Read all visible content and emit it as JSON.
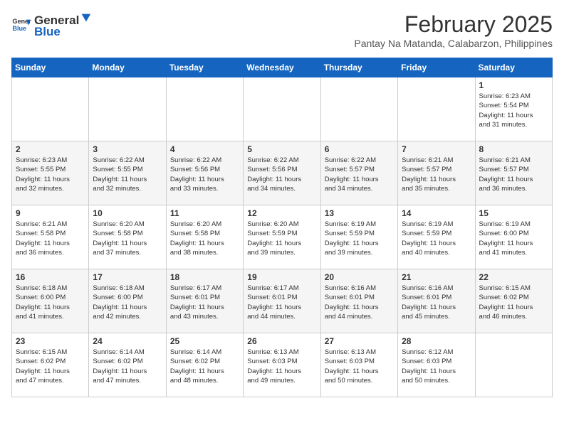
{
  "header": {
    "logo_general": "General",
    "logo_blue": "Blue",
    "month_title": "February 2025",
    "subtitle": "Pantay Na Matanda, Calabarzon, Philippines"
  },
  "days_of_week": [
    "Sunday",
    "Monday",
    "Tuesday",
    "Wednesday",
    "Thursday",
    "Friday",
    "Saturday"
  ],
  "weeks": [
    [
      {
        "num": "",
        "info": ""
      },
      {
        "num": "",
        "info": ""
      },
      {
        "num": "",
        "info": ""
      },
      {
        "num": "",
        "info": ""
      },
      {
        "num": "",
        "info": ""
      },
      {
        "num": "",
        "info": ""
      },
      {
        "num": "1",
        "info": "Sunrise: 6:23 AM\nSunset: 5:54 PM\nDaylight: 11 hours\nand 31 minutes."
      }
    ],
    [
      {
        "num": "2",
        "info": "Sunrise: 6:23 AM\nSunset: 5:55 PM\nDaylight: 11 hours\nand 32 minutes."
      },
      {
        "num": "3",
        "info": "Sunrise: 6:22 AM\nSunset: 5:55 PM\nDaylight: 11 hours\nand 32 minutes."
      },
      {
        "num": "4",
        "info": "Sunrise: 6:22 AM\nSunset: 5:56 PM\nDaylight: 11 hours\nand 33 minutes."
      },
      {
        "num": "5",
        "info": "Sunrise: 6:22 AM\nSunset: 5:56 PM\nDaylight: 11 hours\nand 34 minutes."
      },
      {
        "num": "6",
        "info": "Sunrise: 6:22 AM\nSunset: 5:57 PM\nDaylight: 11 hours\nand 34 minutes."
      },
      {
        "num": "7",
        "info": "Sunrise: 6:21 AM\nSunset: 5:57 PM\nDaylight: 11 hours\nand 35 minutes."
      },
      {
        "num": "8",
        "info": "Sunrise: 6:21 AM\nSunset: 5:57 PM\nDaylight: 11 hours\nand 36 minutes."
      }
    ],
    [
      {
        "num": "9",
        "info": "Sunrise: 6:21 AM\nSunset: 5:58 PM\nDaylight: 11 hours\nand 36 minutes."
      },
      {
        "num": "10",
        "info": "Sunrise: 6:20 AM\nSunset: 5:58 PM\nDaylight: 11 hours\nand 37 minutes."
      },
      {
        "num": "11",
        "info": "Sunrise: 6:20 AM\nSunset: 5:58 PM\nDaylight: 11 hours\nand 38 minutes."
      },
      {
        "num": "12",
        "info": "Sunrise: 6:20 AM\nSunset: 5:59 PM\nDaylight: 11 hours\nand 39 minutes."
      },
      {
        "num": "13",
        "info": "Sunrise: 6:19 AM\nSunset: 5:59 PM\nDaylight: 11 hours\nand 39 minutes."
      },
      {
        "num": "14",
        "info": "Sunrise: 6:19 AM\nSunset: 5:59 PM\nDaylight: 11 hours\nand 40 minutes."
      },
      {
        "num": "15",
        "info": "Sunrise: 6:19 AM\nSunset: 6:00 PM\nDaylight: 11 hours\nand 41 minutes."
      }
    ],
    [
      {
        "num": "16",
        "info": "Sunrise: 6:18 AM\nSunset: 6:00 PM\nDaylight: 11 hours\nand 41 minutes."
      },
      {
        "num": "17",
        "info": "Sunrise: 6:18 AM\nSunset: 6:00 PM\nDaylight: 11 hours\nand 42 minutes."
      },
      {
        "num": "18",
        "info": "Sunrise: 6:17 AM\nSunset: 6:01 PM\nDaylight: 11 hours\nand 43 minutes."
      },
      {
        "num": "19",
        "info": "Sunrise: 6:17 AM\nSunset: 6:01 PM\nDaylight: 11 hours\nand 44 minutes."
      },
      {
        "num": "20",
        "info": "Sunrise: 6:16 AM\nSunset: 6:01 PM\nDaylight: 11 hours\nand 44 minutes."
      },
      {
        "num": "21",
        "info": "Sunrise: 6:16 AM\nSunset: 6:01 PM\nDaylight: 11 hours\nand 45 minutes."
      },
      {
        "num": "22",
        "info": "Sunrise: 6:15 AM\nSunset: 6:02 PM\nDaylight: 11 hours\nand 46 minutes."
      }
    ],
    [
      {
        "num": "23",
        "info": "Sunrise: 6:15 AM\nSunset: 6:02 PM\nDaylight: 11 hours\nand 47 minutes."
      },
      {
        "num": "24",
        "info": "Sunrise: 6:14 AM\nSunset: 6:02 PM\nDaylight: 11 hours\nand 47 minutes."
      },
      {
        "num": "25",
        "info": "Sunrise: 6:14 AM\nSunset: 6:02 PM\nDaylight: 11 hours\nand 48 minutes."
      },
      {
        "num": "26",
        "info": "Sunrise: 6:13 AM\nSunset: 6:03 PM\nDaylight: 11 hours\nand 49 minutes."
      },
      {
        "num": "27",
        "info": "Sunrise: 6:13 AM\nSunset: 6:03 PM\nDaylight: 11 hours\nand 50 minutes."
      },
      {
        "num": "28",
        "info": "Sunrise: 6:12 AM\nSunset: 6:03 PM\nDaylight: 11 hours\nand 50 minutes."
      },
      {
        "num": "",
        "info": ""
      }
    ]
  ]
}
